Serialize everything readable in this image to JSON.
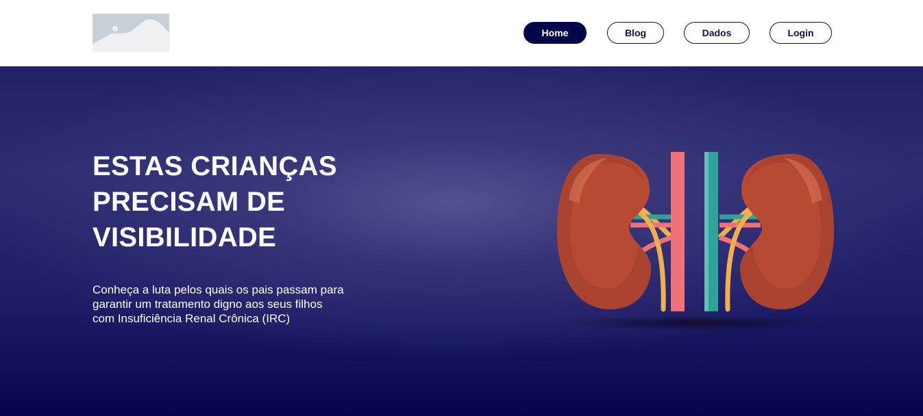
{
  "header": {
    "logo_icon": "image-placeholder-icon",
    "nav": [
      {
        "label": "Home",
        "active": true
      },
      {
        "label": "Blog",
        "active": false
      },
      {
        "label": "Dados",
        "active": false
      },
      {
        "label": "Login",
        "active": false
      }
    ]
  },
  "hero": {
    "headline": "ESTAS CRIANÇAS PRECISAM DE VISIBILIDADE",
    "subtext": "Conheça a luta pelos quais os pais passam para\ngarantir um tratamento digno aos seus filhos\ncom Insuficiência Renal Crônica (IRC)",
    "illustration_icon": "kidneys-illustration"
  },
  "colors": {
    "nav_active": "#05064a",
    "hero_dark": "#06064f",
    "kidney": "#b84a33",
    "artery": "#ee7276",
    "vein": "#2ea39a",
    "ureter": "#f0b04c"
  }
}
